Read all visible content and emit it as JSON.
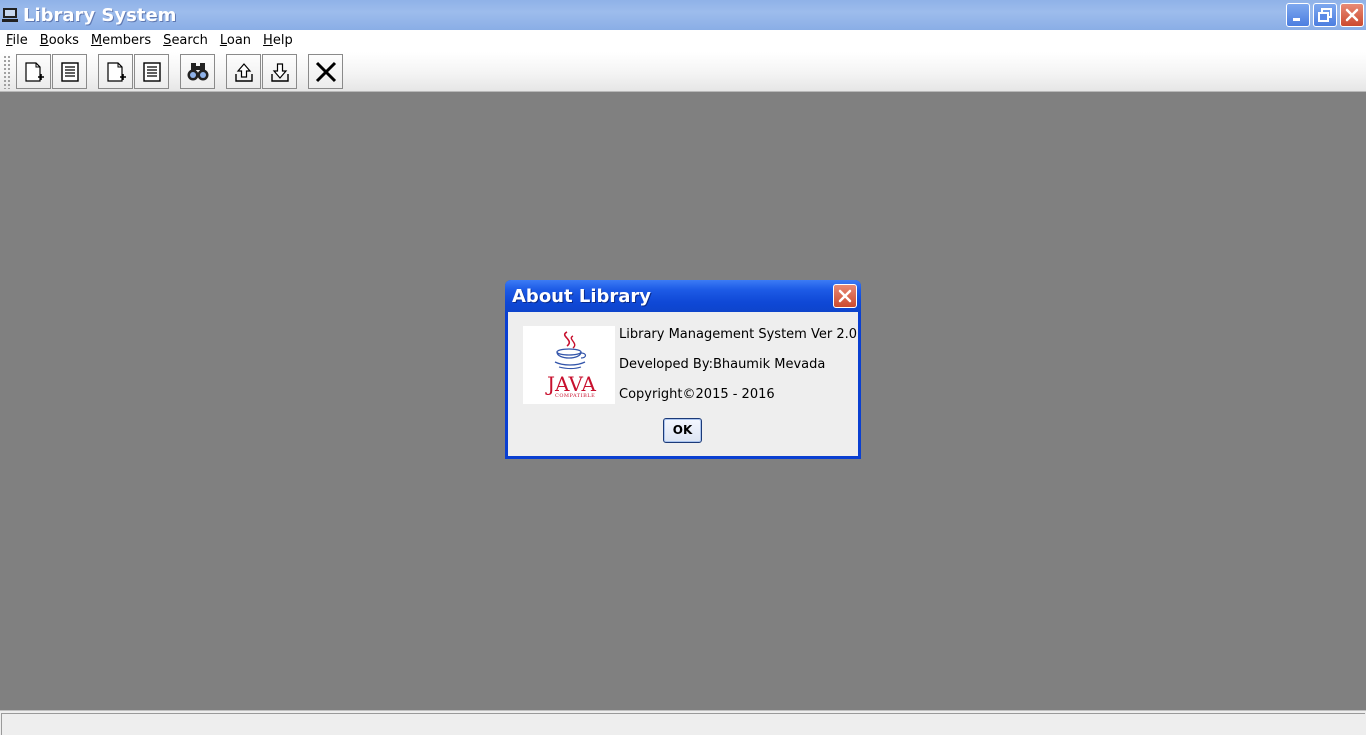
{
  "window": {
    "title": "Library System",
    "buttons": [
      "minimize",
      "restore",
      "close"
    ]
  },
  "menubar": {
    "items": [
      {
        "mnemonic": "F",
        "rest": "ile"
      },
      {
        "mnemonic": "B",
        "rest": "ooks"
      },
      {
        "mnemonic": "M",
        "rest": "embers"
      },
      {
        "mnemonic": "S",
        "rest": "earch"
      },
      {
        "mnemonic": "L",
        "rest": "oan"
      },
      {
        "mnemonic": "H",
        "rest": "elp"
      }
    ]
  },
  "toolbar": {
    "buttons": [
      {
        "icon": "new-document-icon"
      },
      {
        "icon": "list-document-icon"
      },
      {
        "icon": "new-document-icon"
      },
      {
        "icon": "list-document-icon"
      },
      {
        "icon": "binoculars-icon"
      },
      {
        "icon": "upload-icon"
      },
      {
        "icon": "download-icon"
      },
      {
        "icon": "close-x-icon"
      }
    ]
  },
  "dialog": {
    "title": "About Library",
    "logo_text": "JAVA",
    "logo_sub": "COMPATIBLE",
    "line1": "Library Management System Ver 2.0",
    "line2": "Developed By:Bhaumik Mevada",
    "line3": "Copyright©2015 - 2016",
    "ok_label": "OK"
  },
  "colors": {
    "desktop": "#808080",
    "dialog_border": "#0a3fd1",
    "java_red": "#c8102e"
  }
}
